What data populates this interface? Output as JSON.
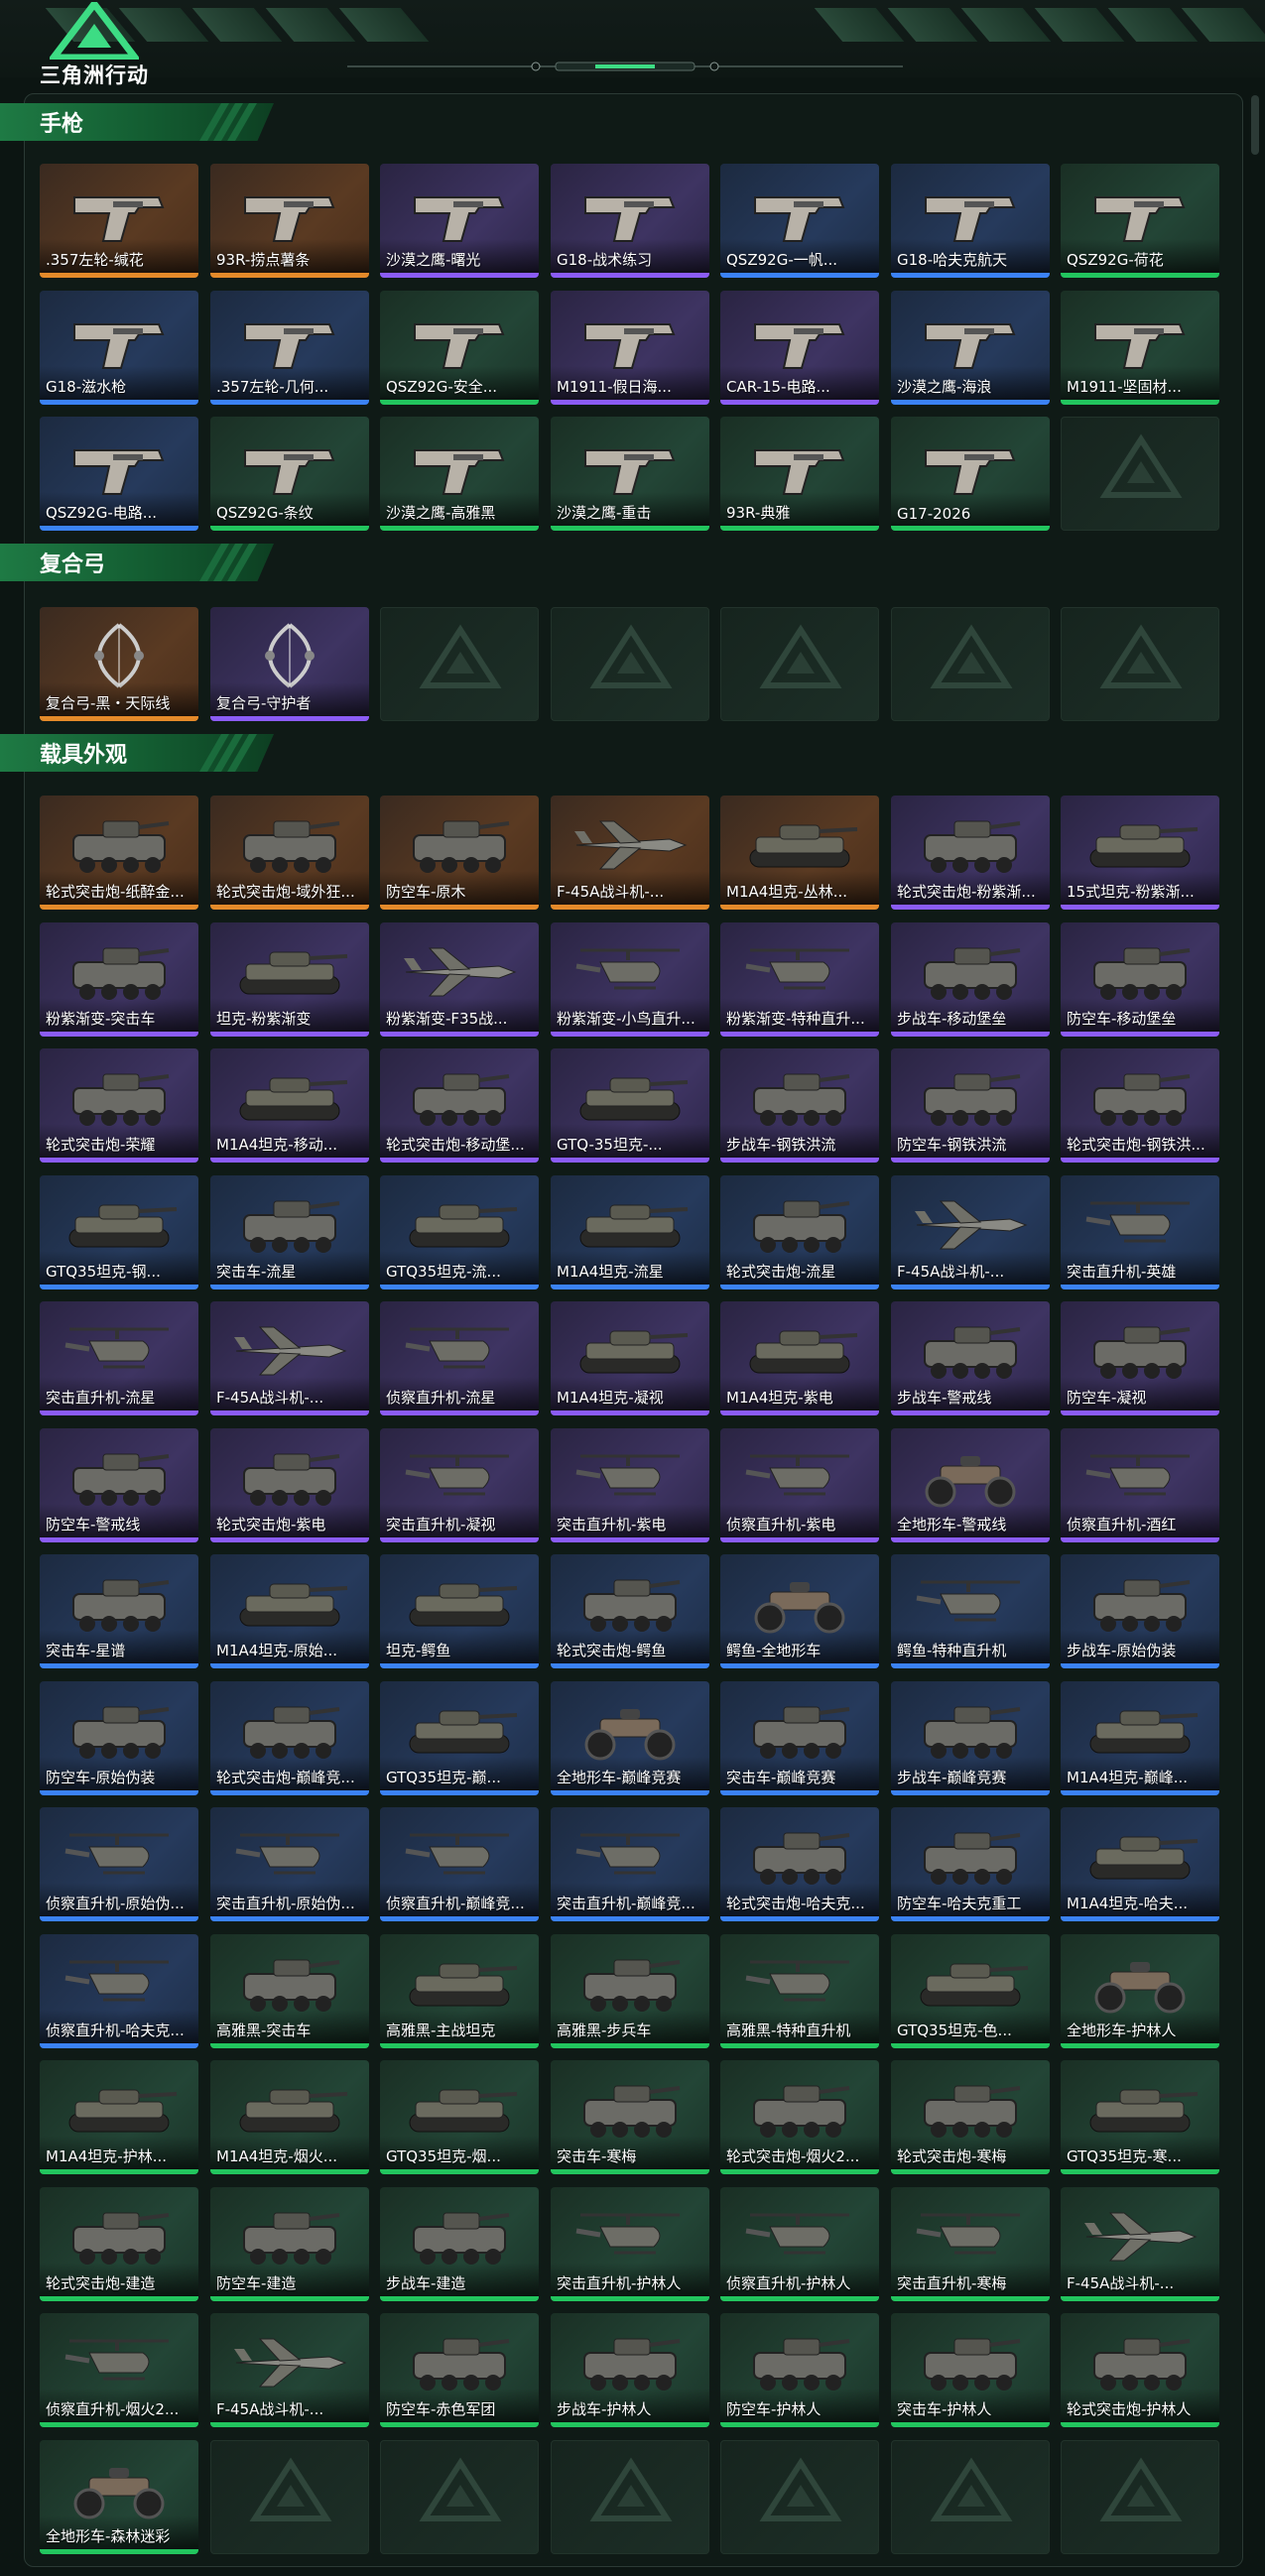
{
  "app": {
    "title": "三角洲行动"
  },
  "sections": [
    {
      "title": "手枪",
      "items": [
        {
          "label": ".357左轮-缄花",
          "rarity": "orange",
          "icon": "pistol-icon"
        },
        {
          "label": "93R-捞点薯条",
          "rarity": "orange",
          "icon": "pistol-icon"
        },
        {
          "label": "沙漠之鹰-曙光",
          "rarity": "purple",
          "icon": "pistol-icon"
        },
        {
          "label": "G18-战术练习",
          "rarity": "purple",
          "icon": "pistol-icon"
        },
        {
          "label": "QSZ92G-一帆...",
          "rarity": "blue",
          "icon": "pistol-icon"
        },
        {
          "label": "G18-哈夫克航天",
          "rarity": "blue",
          "icon": "pistol-icon"
        },
        {
          "label": "QSZ92G-荷花",
          "rarity": "green",
          "icon": "pistol-icon"
        },
        {
          "label": "G18-滋水枪",
          "rarity": "blue",
          "icon": "pistol-icon"
        },
        {
          "label": ".357左轮-几何...",
          "rarity": "blue",
          "icon": "pistol-icon"
        },
        {
          "label": "QSZ92G-安全...",
          "rarity": "green",
          "icon": "pistol-icon"
        },
        {
          "label": "M1911-假日海...",
          "rarity": "purple",
          "icon": "pistol-icon"
        },
        {
          "label": "CAR-15-电路...",
          "rarity": "purple",
          "icon": "pistol-icon"
        },
        {
          "label": "沙漠之鹰-海浪",
          "rarity": "blue",
          "icon": "pistol-icon"
        },
        {
          "label": "M1911-坚固材...",
          "rarity": "green",
          "icon": "pistol-icon"
        },
        {
          "label": "QSZ92G-电路...",
          "rarity": "blue",
          "icon": "pistol-icon"
        },
        {
          "label": "QSZ92G-条纹",
          "rarity": "green",
          "icon": "pistol-icon"
        },
        {
          "label": "沙漠之鹰-高雅黑",
          "rarity": "green",
          "icon": "pistol-icon"
        },
        {
          "label": "沙漠之鹰-重击",
          "rarity": "green",
          "icon": "pistol-icon"
        },
        {
          "label": "93R-典雅",
          "rarity": "green",
          "icon": "pistol-icon"
        },
        {
          "label": "G17-2026",
          "rarity": "green",
          "icon": "pistol-icon"
        },
        {
          "label": "",
          "rarity": "empty",
          "icon": ""
        }
      ]
    },
    {
      "title": "复合弓",
      "items": [
        {
          "label": "复合弓-黑・天际线",
          "rarity": "orange",
          "icon": "bow-icon"
        },
        {
          "label": "复合弓-守护者",
          "rarity": "purple",
          "icon": "bow-icon"
        },
        {
          "label": "",
          "rarity": "empty",
          "icon": ""
        },
        {
          "label": "",
          "rarity": "empty",
          "icon": ""
        },
        {
          "label": "",
          "rarity": "empty",
          "icon": ""
        },
        {
          "label": "",
          "rarity": "empty",
          "icon": ""
        },
        {
          "label": "",
          "rarity": "empty",
          "icon": ""
        }
      ]
    },
    {
      "title": "载具外观",
      "items": [
        {
          "label": "轮式突击炮-纸醉金...",
          "rarity": "orange",
          "icon": "vehicle-icon"
        },
        {
          "label": "轮式突击炮-域外狂...",
          "rarity": "orange",
          "icon": "vehicle-icon"
        },
        {
          "label": "防空车-原木",
          "rarity": "orange",
          "icon": "vehicle-icon"
        },
        {
          "label": "F-45A战斗机-...",
          "rarity": "orange",
          "icon": "jet-icon"
        },
        {
          "label": "M1A4坦克-丛林...",
          "rarity": "orange",
          "icon": "tank-icon"
        },
        {
          "label": "轮式突击炮-粉紫渐...",
          "rarity": "purple",
          "icon": "vehicle-icon"
        },
        {
          "label": "15式坦克-粉紫渐...",
          "rarity": "purple",
          "icon": "tank-icon"
        },
        {
          "label": "粉紫渐变-突击车",
          "rarity": "purple",
          "icon": "vehicle-icon"
        },
        {
          "label": "坦克-粉紫渐变",
          "rarity": "purple",
          "icon": "tank-icon"
        },
        {
          "label": "粉紫渐变-F35战...",
          "rarity": "purple",
          "icon": "jet-icon"
        },
        {
          "label": "粉紫渐变-小鸟直升...",
          "rarity": "purple",
          "icon": "helicopter-icon"
        },
        {
          "label": "粉紫渐变-特种直升...",
          "rarity": "purple",
          "icon": "helicopter-icon"
        },
        {
          "label": "步战车-移动堡垒",
          "rarity": "purple",
          "icon": "vehicle-icon"
        },
        {
          "label": "防空车-移动堡垒",
          "rarity": "purple",
          "icon": "vehicle-icon"
        },
        {
          "label": "轮式突击炮-荣耀",
          "rarity": "purple",
          "icon": "vehicle-icon"
        },
        {
          "label": "M1A4坦克-移动...",
          "rarity": "purple",
          "icon": "tank-icon"
        },
        {
          "label": "轮式突击炮-移动堡...",
          "rarity": "purple",
          "icon": "vehicle-icon"
        },
        {
          "label": "GTQ-35坦克-...",
          "rarity": "purple",
          "icon": "tank-icon"
        },
        {
          "label": "步战车-钢铁洪流",
          "rarity": "purple",
          "icon": "vehicle-icon"
        },
        {
          "label": "防空车-钢铁洪流",
          "rarity": "purple",
          "icon": "vehicle-icon"
        },
        {
          "label": "轮式突击炮-钢铁洪...",
          "rarity": "purple",
          "icon": "vehicle-icon"
        },
        {
          "label": "GTQ35坦克-钢...",
          "rarity": "blue",
          "icon": "tank-icon"
        },
        {
          "label": "突击车-流星",
          "rarity": "blue",
          "icon": "vehicle-icon"
        },
        {
          "label": "GTQ35坦克-流...",
          "rarity": "blue",
          "icon": "tank-icon"
        },
        {
          "label": "M1A4坦克-流星",
          "rarity": "blue",
          "icon": "tank-icon"
        },
        {
          "label": "轮式突击炮-流星",
          "rarity": "blue",
          "icon": "vehicle-icon"
        },
        {
          "label": "F-45A战斗机-...",
          "rarity": "blue",
          "icon": "jet-icon"
        },
        {
          "label": "突击直升机-英雄",
          "rarity": "blue",
          "icon": "helicopter-icon"
        },
        {
          "label": "突击直升机-流星",
          "rarity": "purple",
          "icon": "helicopter-icon"
        },
        {
          "label": "F-45A战斗机-...",
          "rarity": "purple",
          "icon": "jet-icon"
        },
        {
          "label": "侦察直升机-流星",
          "rarity": "purple",
          "icon": "helicopter-icon"
        },
        {
          "label": "M1A4坦克-凝视",
          "rarity": "purple",
          "icon": "tank-icon"
        },
        {
          "label": "M1A4坦克-紫电",
          "rarity": "purple",
          "icon": "tank-icon"
        },
        {
          "label": "步战车-警戒线",
          "rarity": "purple",
          "icon": "vehicle-icon"
        },
        {
          "label": "防空车-凝视",
          "rarity": "purple",
          "icon": "vehicle-icon"
        },
        {
          "label": "防空车-警戒线",
          "rarity": "purple",
          "icon": "vehicle-icon"
        },
        {
          "label": "轮式突击炮-紫电",
          "rarity": "purple",
          "icon": "vehicle-icon"
        },
        {
          "label": "突击直升机-凝视",
          "rarity": "purple",
          "icon": "helicopter-icon"
        },
        {
          "label": "突击直升机-紫电",
          "rarity": "purple",
          "icon": "helicopter-icon"
        },
        {
          "label": "侦察直升机-紫电",
          "rarity": "purple",
          "icon": "helicopter-icon"
        },
        {
          "label": "全地形车-警戒线",
          "rarity": "purple",
          "icon": "atv-icon"
        },
        {
          "label": "侦察直升机-酒红",
          "rarity": "purple",
          "icon": "helicopter-icon"
        },
        {
          "label": "突击车-星谱",
          "rarity": "blue",
          "icon": "vehicle-icon"
        },
        {
          "label": "M1A4坦克-原始...",
          "rarity": "blue",
          "icon": "tank-icon"
        },
        {
          "label": "坦克-鳄鱼",
          "rarity": "blue",
          "icon": "tank-icon"
        },
        {
          "label": "轮式突击炮-鳄鱼",
          "rarity": "blue",
          "icon": "vehicle-icon"
        },
        {
          "label": "鳄鱼-全地形车",
          "rarity": "blue",
          "icon": "atv-icon"
        },
        {
          "label": "鳄鱼-特种直升机",
          "rarity": "blue",
          "icon": "helicopter-icon"
        },
        {
          "label": "步战车-原始伪装",
          "rarity": "blue",
          "icon": "vehicle-icon"
        },
        {
          "label": "防空车-原始伪装",
          "rarity": "blue",
          "icon": "vehicle-icon"
        },
        {
          "label": "轮式突击炮-巅峰竞...",
          "rarity": "blue",
          "icon": "vehicle-icon"
        },
        {
          "label": "GTQ35坦克-巅...",
          "rarity": "blue",
          "icon": "tank-icon"
        },
        {
          "label": "全地形车-巅峰竞赛",
          "rarity": "blue",
          "icon": "atv-icon"
        },
        {
          "label": "突击车-巅峰竞赛",
          "rarity": "blue",
          "icon": "vehicle-icon"
        },
        {
          "label": "步战车-巅峰竞赛",
          "rarity": "blue",
          "icon": "vehicle-icon"
        },
        {
          "label": "M1A4坦克-巅峰...",
          "rarity": "blue",
          "icon": "tank-icon"
        },
        {
          "label": "侦察直升机-原始伪...",
          "rarity": "blue",
          "icon": "helicopter-icon"
        },
        {
          "label": "突击直升机-原始伪...",
          "rarity": "blue",
          "icon": "helicopter-icon"
        },
        {
          "label": "侦察直升机-巅峰竞...",
          "rarity": "blue",
          "icon": "helicopter-icon"
        },
        {
          "label": "突击直升机-巅峰竞...",
          "rarity": "blue",
          "icon": "helicopter-icon"
        },
        {
          "label": "轮式突击炮-哈夫克...",
          "rarity": "blue",
          "icon": "vehicle-icon"
        },
        {
          "label": "防空车-哈夫克重工",
          "rarity": "blue",
          "icon": "vehicle-icon"
        },
        {
          "label": "M1A4坦克-哈夫...",
          "rarity": "blue",
          "icon": "tank-icon"
        },
        {
          "label": "侦察直升机-哈夫克...",
          "rarity": "blue",
          "icon": "helicopter-icon"
        },
        {
          "label": "高雅黑-突击车",
          "rarity": "green",
          "icon": "vehicle-icon"
        },
        {
          "label": "高雅黑-主战坦克",
          "rarity": "green",
          "icon": "tank-icon"
        },
        {
          "label": "高雅黑-步兵车",
          "rarity": "green",
          "icon": "vehicle-icon"
        },
        {
          "label": "高雅黑-特种直升机",
          "rarity": "green",
          "icon": "helicopter-icon"
        },
        {
          "label": "GTQ35坦克-色...",
          "rarity": "green",
          "icon": "tank-icon"
        },
        {
          "label": "全地形车-护林人",
          "rarity": "green",
          "icon": "atv-icon"
        },
        {
          "label": "M1A4坦克-护林...",
          "rarity": "green",
          "icon": "tank-icon"
        },
        {
          "label": "M1A4坦克-烟火...",
          "rarity": "green",
          "icon": "tank-icon"
        },
        {
          "label": "GTQ35坦克-烟...",
          "rarity": "green",
          "icon": "tank-icon"
        },
        {
          "label": "突击车-寒梅",
          "rarity": "green",
          "icon": "vehicle-icon"
        },
        {
          "label": "轮式突击炮-烟火2...",
          "rarity": "green",
          "icon": "vehicle-icon"
        },
        {
          "label": "轮式突击炮-寒梅",
          "rarity": "green",
          "icon": "vehicle-icon"
        },
        {
          "label": "GTQ35坦克-寒...",
          "rarity": "green",
          "icon": "tank-icon"
        },
        {
          "label": "轮式突击炮-建造",
          "rarity": "green",
          "icon": "vehicle-icon"
        },
        {
          "label": "防空车-建造",
          "rarity": "green",
          "icon": "vehicle-icon"
        },
        {
          "label": "步战车-建造",
          "rarity": "green",
          "icon": "vehicle-icon"
        },
        {
          "label": "突击直升机-护林人",
          "rarity": "green",
          "icon": "helicopter-icon"
        },
        {
          "label": "侦察直升机-护林人",
          "rarity": "green",
          "icon": "helicopter-icon"
        },
        {
          "label": "突击直升机-寒梅",
          "rarity": "green",
          "icon": "helicopter-icon"
        },
        {
          "label": "F-45A战斗机-...",
          "rarity": "green",
          "icon": "jet-icon"
        },
        {
          "label": "侦察直升机-烟火2...",
          "rarity": "green",
          "icon": "helicopter-icon"
        },
        {
          "label": "F-45A战斗机-...",
          "rarity": "green",
          "icon": "jet-icon"
        },
        {
          "label": "防空车-赤色军团",
          "rarity": "green",
          "icon": "vehicle-icon"
        },
        {
          "label": "步战车-护林人",
          "rarity": "green",
          "icon": "vehicle-icon"
        },
        {
          "label": "防空车-护林人",
          "rarity": "green",
          "icon": "vehicle-icon"
        },
        {
          "label": "突击车-护林人",
          "rarity": "green",
          "icon": "vehicle-icon"
        },
        {
          "label": "轮式突击炮-护林人",
          "rarity": "green",
          "icon": "vehicle-icon"
        },
        {
          "label": "全地形车-森林迷彩",
          "rarity": "green",
          "icon": "atv-icon"
        },
        {
          "label": "",
          "rarity": "empty",
          "icon": ""
        },
        {
          "label": "",
          "rarity": "empty",
          "icon": ""
        },
        {
          "label": "",
          "rarity": "empty",
          "icon": ""
        },
        {
          "label": "",
          "rarity": "empty",
          "icon": ""
        },
        {
          "label": "",
          "rarity": "empty",
          "icon": ""
        },
        {
          "label": "",
          "rarity": "empty",
          "icon": ""
        }
      ]
    }
  ],
  "colors": {
    "orange": "#e58a2a",
    "purple": "#8b5cf6",
    "blue": "#3b82f6",
    "green": "#22c55e",
    "accent": "#1e7a44"
  }
}
